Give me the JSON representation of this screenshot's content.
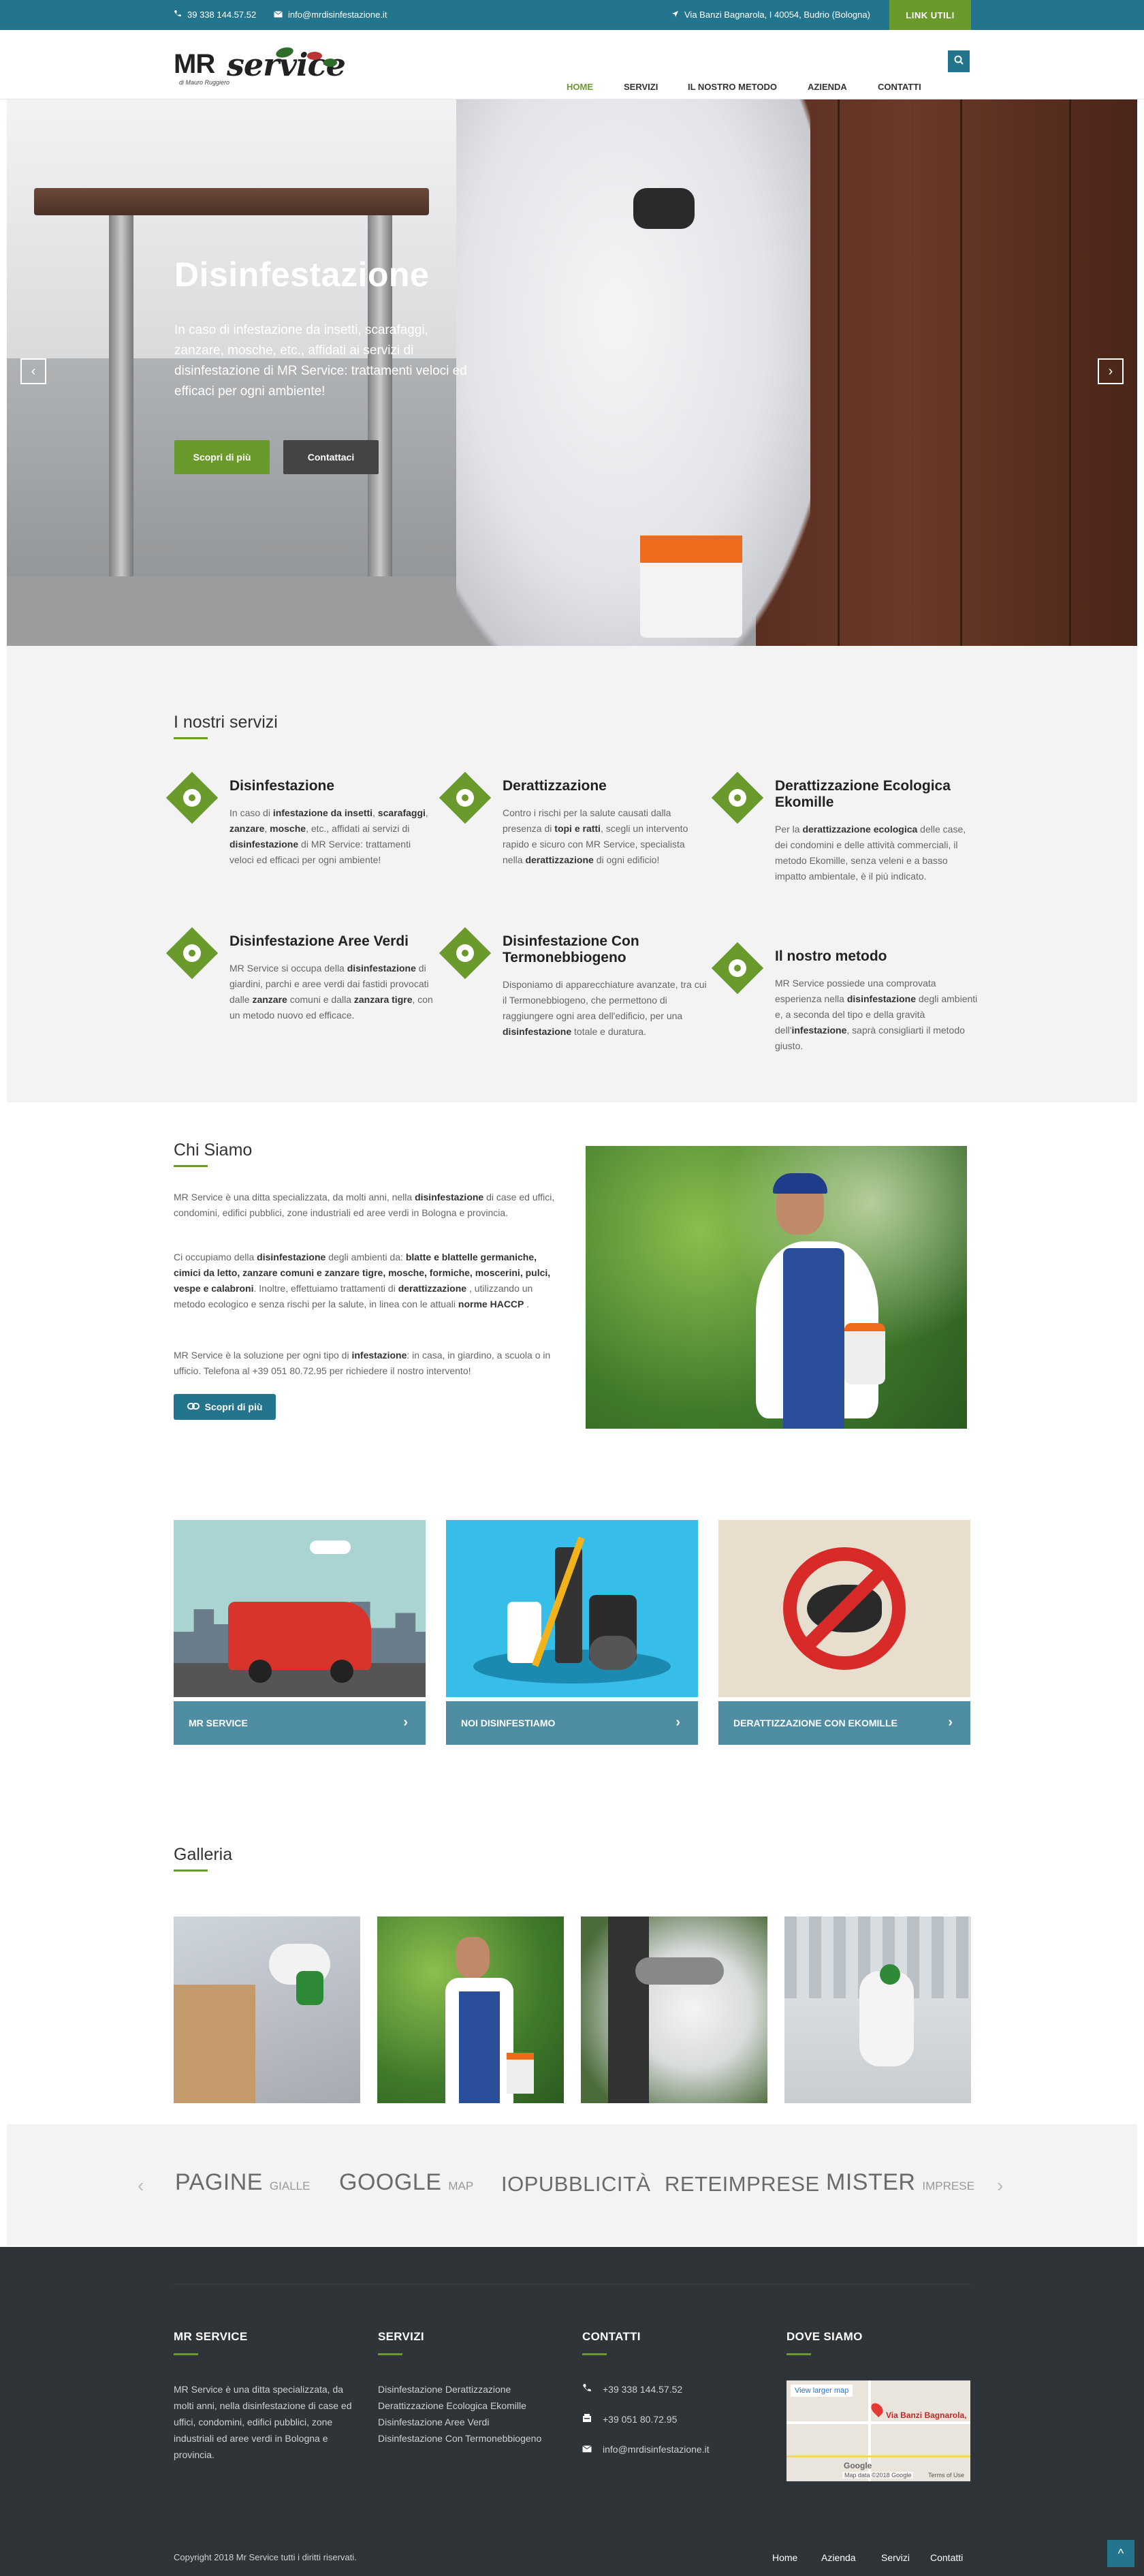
{
  "topbar": {
    "phone": "39 338 144.57.52",
    "email": "info@mrdisinfestazione.it",
    "address": "Via Banzi Bagnarola, I 40054, Budrio (Bologna)",
    "link_button": "LINK UTILI"
  },
  "header": {
    "logo_mr": "MR",
    "logo_service": "service",
    "logo_sub": "di Mauro Ruggiero",
    "nav": [
      "HOME",
      "SERVIZI",
      "IL NOSTRO METODO",
      "AZIENDA",
      "CONTATTI"
    ],
    "active": "HOME"
  },
  "hero": {
    "title": "Disinfestazione",
    "text": "In caso di infestazione da insetti, scarafaggi, zanzare, mosche, etc., affidati ai servizi di disinfestazione di MR Service: trattamenti veloci ed efficaci per ogni ambiente!",
    "btn_more": "Scopri di più",
    "btn_contact": "Contattaci"
  },
  "services": {
    "title": "I nostri servizi",
    "items": [
      {
        "title": "Disinfestazione",
        "text_html": "In caso di <b>infestazione da insetti</b>, <b>scarafaggi</b>, <b>zanzare</b>, <b>mosche</b>, etc., affidati ai servizi di <b>disinfestazione</b> di MR Service: trattamenti veloci ed efficaci per ogni ambiente!"
      },
      {
        "title": "Derattizzazione",
        "text_html": "Contro i rischi per la salute causati dalla presenza di <b>topi e ratti</b>, scegli un intervento rapido e sicuro con MR Service, specialista nella <b>derattizzazione</b> di ogni edificio!"
      },
      {
        "title": "Derattizzazione Ecologica Ekomille",
        "text_html": "Per la <b>derattizzazione ecologica</b> delle case, dei condomini e delle attività commerciali, il metodo Ekomille, senza veleni e a basso impatto ambientale, è il più indicato."
      },
      {
        "title": "Disinfestazione Aree Verdi",
        "text_html": "MR Service si occupa della <b>disinfestazione</b> di giardini, parchi e aree verdi dai fastidi provocati dalle <b>zanzare</b> comuni e dalla <b>zanzara tigre</b>, con un metodo nuovo ed efficace."
      },
      {
        "title": "Disinfestazione Con Termonebbiogeno",
        "text_html": "Disponiamo di apparecchiature avanzate, tra cui il Termonebbiogeno, che permettono di raggiungere ogni area dell'edificio, per una <b>disinfestazione</b> totale e duratura."
      },
      {
        "title": "Il nostro metodo",
        "text_html": "MR Service possiede una comprovata esperienza nella <b>disinfestazione</b> degli ambienti e, a seconda del tipo e della gravità dell'<b>infestazione</b>, saprà consigliarti il metodo giusto."
      }
    ]
  },
  "chi_siamo": {
    "title": "Chi Siamo",
    "p1_html": "MR Service è una ditta specializzata, da molti anni, nella <b>disinfestazione</b> di case ed uffici, condomini, edifici pubblici, zone industriali ed aree verdi in Bologna e provincia.",
    "p2_html": "Ci occupiamo della <b>disinfestazione</b> degli ambienti da: <b>blatte e blattelle germaniche, cimici da letto, zanzare comuni e zanzare tigre, mosche, formiche, moscerini, pulci, vespe e calabroni</b>. Inoltre, effettuiamo trattamenti di <b>derattizzazione</b> , utilizzando un metodo ecologico e senza rischi per la salute, in linea con le attuali <b>norme HACCP</b> .",
    "p3_html": "MR Service è la soluzione per ogni tipo di <b>infestazione</b>: in casa, in giardino, a scuola o in ufficio. Telefona al +39 051 80.72.95 per richiedere il nostro intervento!",
    "btn": "Scopri di più"
  },
  "cards": [
    {
      "label": "MR SERVICE"
    },
    {
      "label": "NOI DISINFESTIAMO"
    },
    {
      "label": "DERATTIZZAZIONE CON EKOMILLE"
    }
  ],
  "gallery": {
    "title": "Galleria"
  },
  "partners": [
    {
      "main": "PAGINE",
      "small": "GIALLE"
    },
    {
      "main": "GOOGLE",
      "small": "MAP"
    },
    {
      "main": "IOPUBBLICITÀ",
      "small": ""
    },
    {
      "main": "RETEIMPRESE",
      "small": ""
    },
    {
      "main": "MISTER",
      "small": "IMPRESE"
    }
  ],
  "footer": {
    "col1_title": "MR SERVICE",
    "col1_text": "MR Service è una ditta specializzata, da molti anni, nella disinfestazione di case ed uffici, condomini, edifici pubblici, zone industriali ed aree verdi in Bologna e provincia.",
    "col2_title": "SERVIZI",
    "col2_links": [
      "Disinfestazione",
      "Derattizzazione",
      "Derattizzazione Ecologica Ekomille",
      "Disinfestazione Aree Verdi",
      "Disinfestazione Con Termonebbiogeno"
    ],
    "col3_title": "CONTATTI",
    "phone1": "+39 338 144.57.52",
    "phone2": "+39 051 80.72.95",
    "email": "info@mrdisinfestazione.it",
    "col4_title": "DOVE SIAMO",
    "map_link": "View larger map",
    "map_place": "Via Banzi Bagnarola,",
    "map_data": "Map data ©2018 Google",
    "map_terms": "Terms of Use",
    "copyright": "Copyright 2018 Mr Service tutti i diritti riservati.",
    "links": [
      "Home",
      "Azienda",
      "Servizi",
      "Contatti"
    ]
  },
  "colors": {
    "teal": "#23758e",
    "green": "#6a9a2c",
    "footer": "#2f3439",
    "card": "#4e8da2"
  }
}
